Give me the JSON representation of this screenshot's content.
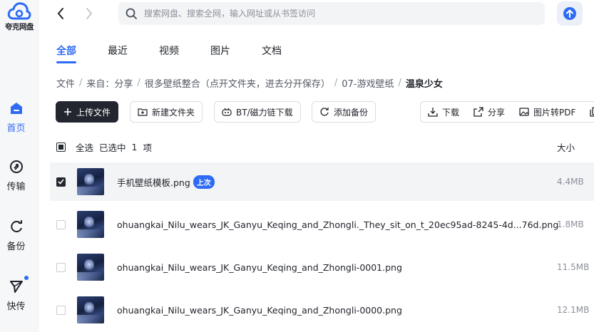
{
  "app": {
    "logo_text": "夸克网盘"
  },
  "nav": [
    {
      "label": "首页",
      "icon": "home-icon",
      "active": true
    },
    {
      "label": "传输",
      "icon": "transfer-icon",
      "active": false
    },
    {
      "label": "备份",
      "icon": "backup-icon",
      "active": false
    },
    {
      "label": "快传",
      "icon": "quick-send-icon",
      "active": false
    }
  ],
  "search": {
    "placeholder": "搜索网盘、搜索全网，输入网址或从书签访问"
  },
  "tabs": [
    "全部",
    "最近",
    "视频",
    "图片",
    "文档"
  ],
  "breadcrumb": {
    "items": [
      "文件",
      "来自：分享",
      "很多壁纸整合（点开文件夹，进去分开保存）",
      "07-游戏壁纸"
    ],
    "current": "温泉少女"
  },
  "toolbar": {
    "upload": "上传文件",
    "new_folder": "新建文件夹",
    "bt": "BT/磁力链下载",
    "backup": "添加备份"
  },
  "actions": {
    "download": "下载",
    "share": "分享",
    "to_pdf": "图片转PDF"
  },
  "list": {
    "select_all": "全选",
    "selected_prefix": "已选中",
    "selected_count": "1",
    "selected_suffix": "项",
    "size_header": "大小",
    "files": [
      {
        "name": "手机壁纸模板.png",
        "badge": "上次",
        "size": "4.4MB",
        "selected": true
      },
      {
        "name": "ohuangkai_Nilu_wears_JK_Ganyu_Keqing_and_Zhongli._They_sit_on_t_20ec95ad-8245-4d...76d.png",
        "badge": "",
        "size": "1.8MB",
        "selected": false
      },
      {
        "name": "ohuangkai_Nilu_wears_JK_Ganyu_Keqing_and_Zhongli-0001.png",
        "badge": "",
        "size": "11.5MB",
        "selected": false
      },
      {
        "name": "ohuangkai_Nilu_wears_JK_Ganyu_Keqing_and_Zhongli-0000.png",
        "badge": "",
        "size": "12.1MB",
        "selected": false
      }
    ]
  },
  "colors": {
    "accent": "#2e6bf5",
    "dark": "#23262e"
  }
}
